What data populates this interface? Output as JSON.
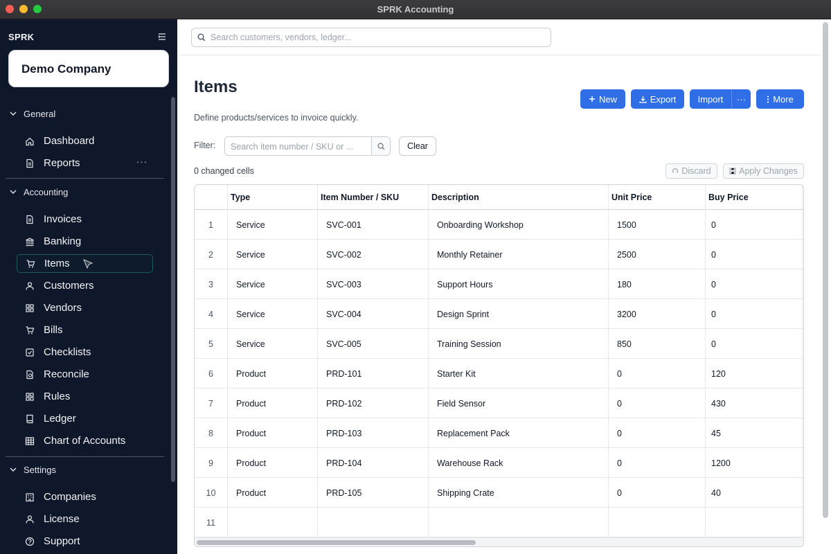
{
  "window": {
    "title": "SPRK Accounting"
  },
  "sidebar": {
    "brand": "SPRK",
    "company": "Demo Company",
    "sections": [
      {
        "label": "General",
        "items": [
          {
            "label": "Dashboard",
            "icon": "home-icon"
          },
          {
            "label": "Reports",
            "icon": "document-icon",
            "more": "···"
          }
        ]
      },
      {
        "label": "Accounting",
        "items": [
          {
            "label": "Invoices",
            "icon": "document-icon"
          },
          {
            "label": "Banking",
            "icon": "bank-icon"
          },
          {
            "label": "Items",
            "icon": "cart-icon",
            "active": true
          },
          {
            "label": "Customers",
            "icon": "user-icon"
          },
          {
            "label": "Vendors",
            "icon": "grid-icon"
          },
          {
            "label": "Bills",
            "icon": "cart-icon"
          },
          {
            "label": "Checklists",
            "icon": "checkbox-icon"
          },
          {
            "label": "Reconcile",
            "icon": "reconcile-icon"
          },
          {
            "label": "Rules",
            "icon": "grid-icon"
          },
          {
            "label": "Ledger",
            "icon": "book-icon"
          },
          {
            "label": "Chart of Accounts",
            "icon": "table-icon"
          }
        ]
      },
      {
        "label": "Settings",
        "items": [
          {
            "label": "Companies",
            "icon": "building-icon"
          },
          {
            "label": "License",
            "icon": "user-icon"
          },
          {
            "label": "Support",
            "icon": "help-icon"
          }
        ]
      }
    ]
  },
  "search": {
    "placeholder": "Search customers, vendors, ledger..."
  },
  "page": {
    "title": "Items",
    "subtitle": "Define products/services to invoice quickly.",
    "buttons": {
      "new": "New",
      "export": "Export",
      "import": "Import",
      "import_more": "···",
      "more": "More"
    },
    "filter": {
      "label": "Filter:",
      "placeholder": "Search item number / SKU or ...",
      "clear": "Clear"
    },
    "changed": "0 changed cells",
    "discard": "Discard",
    "apply": "Apply Changes"
  },
  "table": {
    "columns": [
      "Type",
      "Item Number / SKU",
      "Description",
      "Unit Price",
      "Buy Price"
    ],
    "rows": [
      {
        "n": "1",
        "type": "Service",
        "sku": "SVC-001",
        "desc": "Onboarding Workshop",
        "unit": "1500",
        "buy": "0"
      },
      {
        "n": "2",
        "type": "Service",
        "sku": "SVC-002",
        "desc": "Monthly Retainer",
        "unit": "2500",
        "buy": "0"
      },
      {
        "n": "3",
        "type": "Service",
        "sku": "SVC-003",
        "desc": "Support Hours",
        "unit": "180",
        "buy": "0"
      },
      {
        "n": "4",
        "type": "Service",
        "sku": "SVC-004",
        "desc": "Design Sprint",
        "unit": "3200",
        "buy": "0"
      },
      {
        "n": "5",
        "type": "Service",
        "sku": "SVC-005",
        "desc": "Training Session",
        "unit": "850",
        "buy": "0"
      },
      {
        "n": "6",
        "type": "Product",
        "sku": "PRD-101",
        "desc": "Starter Kit",
        "unit": "0",
        "buy": "120"
      },
      {
        "n": "7",
        "type": "Product",
        "sku": "PRD-102",
        "desc": "Field Sensor",
        "unit": "0",
        "buy": "430"
      },
      {
        "n": "8",
        "type": "Product",
        "sku": "PRD-103",
        "desc": "Replacement Pack",
        "unit": "0",
        "buy": "45"
      },
      {
        "n": "9",
        "type": "Product",
        "sku": "PRD-104",
        "desc": "Warehouse Rack",
        "unit": "0",
        "buy": "1200"
      },
      {
        "n": "10",
        "type": "Product",
        "sku": "PRD-105",
        "desc": "Shipping Crate",
        "unit": "0",
        "buy": "40"
      },
      {
        "n": "11",
        "type": "",
        "sku": "",
        "desc": "",
        "unit": "",
        "buy": ""
      }
    ]
  },
  "colors": {
    "sidebar_bg": "#0f172a",
    "accent": "#2f6ee6",
    "active_border": "#1f5c55"
  }
}
